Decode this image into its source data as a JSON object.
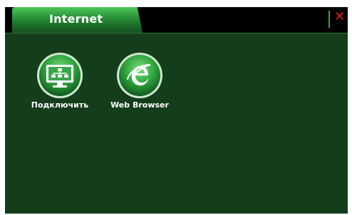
{
  "window": {
    "tab_title": "Internet",
    "close_glyph": "✕",
    "accent_color": "#2faa3f",
    "background_color": "#143d1c",
    "close_color": "#e01a1a"
  },
  "apps": [
    {
      "label": "Подключить",
      "icon": "network-connect-icon"
    },
    {
      "label": "Web Browser",
      "icon": "web-browser-icon"
    }
  ]
}
